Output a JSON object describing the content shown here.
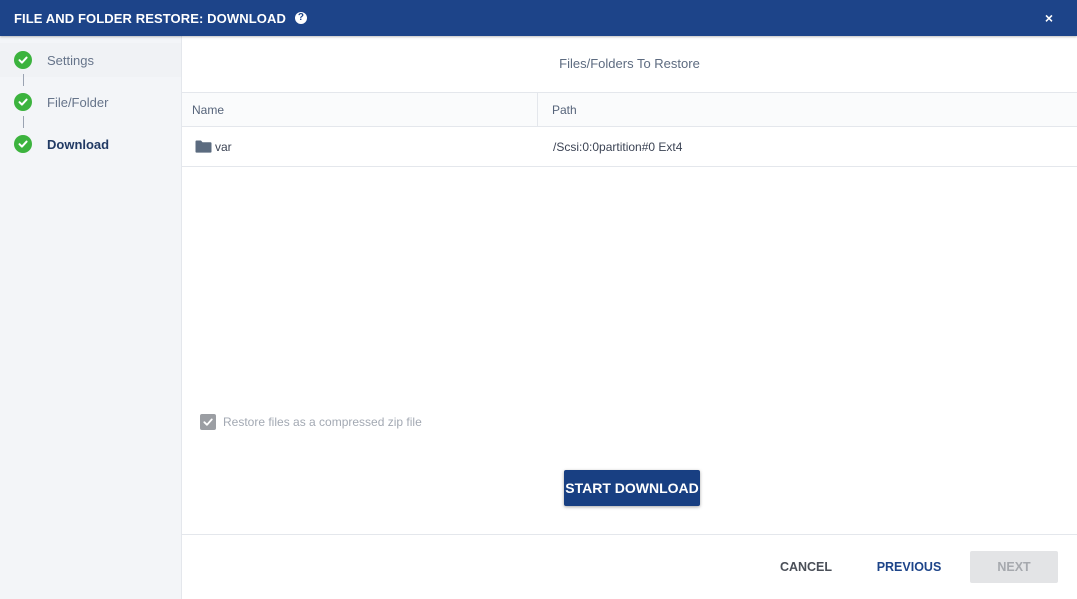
{
  "window": {
    "title": "FILE AND FOLDER RESTORE: DOWNLOAD",
    "help_icon": "?",
    "close_icon": "×"
  },
  "wizard_steps": [
    {
      "label": "Settings",
      "status": "complete",
      "icon": "check-circle-icon"
    },
    {
      "label": "File/Folder",
      "status": "complete",
      "icon": "check-circle-icon"
    },
    {
      "label": "Download",
      "status": "complete",
      "current": true,
      "icon": "check-circle-icon"
    }
  ],
  "main": {
    "section_title": "Files/Folders To Restore",
    "table": {
      "columns": [
        "Name",
        "Path"
      ],
      "rows": [
        {
          "name": "var",
          "path": "/Scsi:0:0partition#0 Ext4",
          "icon": "folder-icon"
        }
      ]
    },
    "zip_option": {
      "label": "Restore files as a compressed zip file",
      "checked": true,
      "disabled": true
    },
    "start_download_label": "START DOWNLOAD"
  },
  "footer": {
    "cancel_label": "CANCEL",
    "previous_label": "PREVIOUS",
    "next_label": "NEXT"
  },
  "colors": {
    "header_bg": "#1d4489",
    "step_complete": "#3cb33e",
    "primary_button": "#183f82",
    "disabled_button": "#e3e4e6"
  }
}
